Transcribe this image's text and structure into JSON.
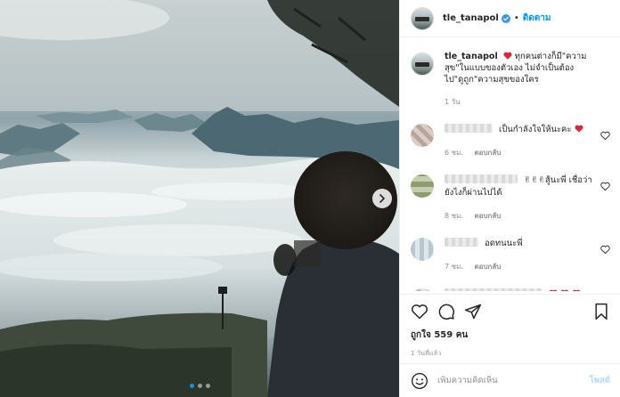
{
  "post": {
    "username": "tle_tanapol",
    "follow_label": "ติดตาม",
    "separator": "•",
    "caption": "ทุกคนต่างก็มี\"ความสุข\"ในแบบของตัวเอง ไม่จำเป็นต้องไป\"ดูถูก\"ความสุขของใคร",
    "caption_time": "1 วัน",
    "likes": "ถูกใจ 559 คน",
    "time_ago": "1 วันที่แล้ว"
  },
  "carousel": {
    "slide_count": 3,
    "active_index": 0
  },
  "comments": [
    {
      "text": "เป็นกำลังใจให้นะคะ",
      "time": "6 ชม.",
      "reply": "ตอบกลับ",
      "emoji": "heart"
    },
    {
      "text": "✌✌✌สู้นะพี่ เชื่อว่ายังไงก็ผ่านไปได้",
      "time": "8 ชม.",
      "reply": "ตอบกลับ",
      "emoji": ""
    },
    {
      "text": "อดทนนะพี่",
      "time": "7 ชม.",
      "reply": "ตอบกลับ",
      "emoji": ""
    }
  ],
  "add_comment": {
    "placeholder": "เพิ่มความคิดเห็น",
    "post_label": "โพสต์"
  },
  "colors": {
    "accent": "#0095f6",
    "heart": "#ed4956",
    "post_disabled": "#b3dbff"
  },
  "icons": [
    "verified-icon",
    "heart-icon",
    "comment-icon",
    "share-icon",
    "save-icon",
    "emoji-icon",
    "chevron-right-icon"
  ]
}
